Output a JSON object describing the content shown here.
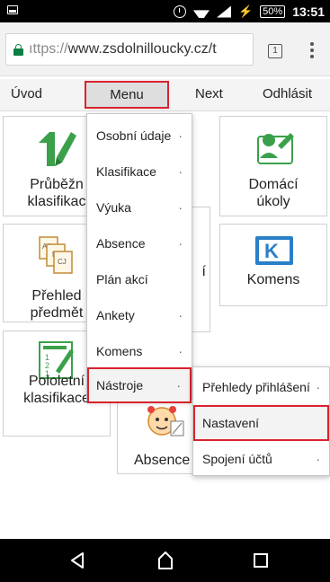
{
  "status_bar": {
    "battery": "50%",
    "time": "13:51",
    "icons": [
      "screenshot-icon",
      "alarm-icon",
      "wifi-icon",
      "signal-icon",
      "charging-icon",
      "battery-icon"
    ]
  },
  "browser": {
    "url_scheme": "ıttps://",
    "url_rest": "www.zsdolnilloucky.cz/t",
    "tab_count": "1"
  },
  "site_nav": {
    "items": [
      "Úvod",
      "Menu",
      "Next",
      "Odhlásit"
    ]
  },
  "tiles": {
    "prubezna": [
      "Průběžn",
      "klasifikac"
    ],
    "domaci": [
      "Domácí",
      "úkoly"
    ],
    "prehled": [
      "Přehled",
      "předmět"
    ],
    "hidden_mid": "í",
    "komens": "Komens",
    "pololetni": [
      "Pololetní",
      "klasifikace"
    ],
    "absence": "Absence"
  },
  "menu": {
    "items": [
      {
        "label": "Osobní údaje",
        "arrow": "·"
      },
      {
        "label": "Klasifikace",
        "arrow": "·"
      },
      {
        "label": "Výuka",
        "arrow": "·"
      },
      {
        "label": "Absence",
        "arrow": "·"
      },
      {
        "label": "Plán akcí",
        "arrow": ""
      },
      {
        "label": "Ankety",
        "arrow": "·"
      },
      {
        "label": "Komens",
        "arrow": "·"
      },
      {
        "label": "Nástroje",
        "arrow": "·"
      }
    ]
  },
  "submenu": {
    "items": [
      {
        "label": "Přehledy přihlášení",
        "arrow": "·"
      },
      {
        "label": "Nastavení",
        "arrow": ""
      },
      {
        "label": "Spojení účtů",
        "arrow": "·"
      }
    ]
  },
  "colors": {
    "highlight": "#d9232d",
    "green": "#0b8043"
  }
}
